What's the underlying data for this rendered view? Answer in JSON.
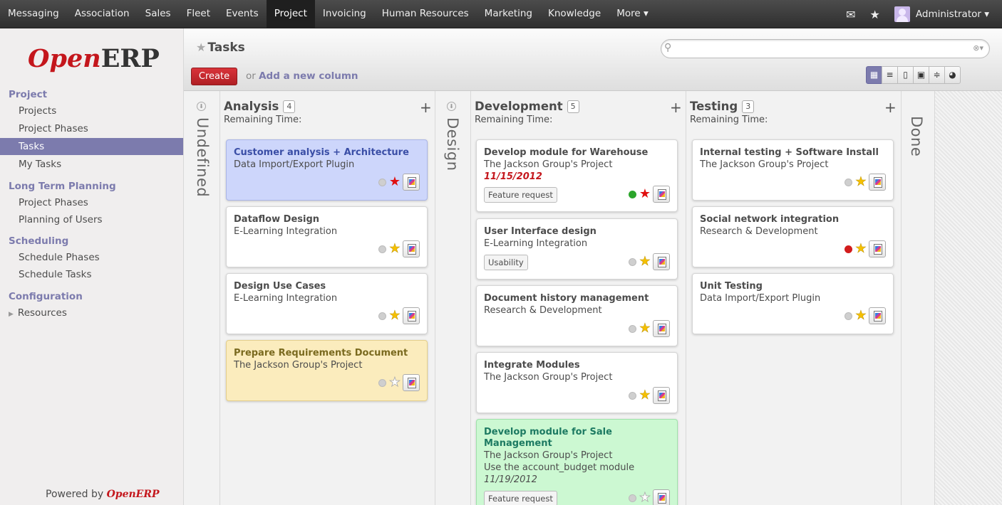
{
  "topbar": {
    "menu": [
      "Messaging",
      "Association",
      "Sales",
      "Fleet",
      "Events",
      "Project",
      "Invoicing",
      "Human Resources",
      "Marketing",
      "Knowledge",
      "More ▾"
    ],
    "active_index": 5,
    "user": "Administrator ▾"
  },
  "sidebar": {
    "logo_open": "Open",
    "logo_erp": "ERP",
    "sections": [
      {
        "title": "Project",
        "items": [
          "Projects",
          "Project Phases",
          "Tasks",
          "My Tasks"
        ]
      },
      {
        "title": "Long Term Planning",
        "items": [
          "Project Phases",
          "Planning of Users"
        ]
      },
      {
        "title": "Scheduling",
        "items": [
          "Schedule Phases",
          "Schedule Tasks"
        ]
      },
      {
        "title": "Configuration",
        "items": [
          "Resources"
        ]
      }
    ],
    "active_item": "Tasks",
    "powered_by": "Powered by",
    "powered_brand": "OpenERP"
  },
  "view": {
    "title": "Tasks",
    "create_label": "Create",
    "or_text": "or",
    "add_column_label": "Add a new column",
    "search_placeholder": "",
    "view_modes": [
      "kanban",
      "list",
      "form",
      "calendar",
      "gantt",
      "graph"
    ],
    "active_view": "kanban"
  },
  "kanban": {
    "folded": [
      "Undefined",
      "Design",
      "Done"
    ],
    "columns": [
      {
        "title": "Analysis",
        "count": "4",
        "remaining": "Remaining Time:",
        "cards": [
          {
            "name": "Customer analysis + Architecture",
            "project": "Data Import/Export Plugin",
            "color": "blue",
            "state": "grey",
            "star": "red"
          },
          {
            "name": "Dataflow Design",
            "project": "E-Learning Integration",
            "state": "grey",
            "star": "gold"
          },
          {
            "name": "Design Use Cases",
            "project": "E-Learning Integration",
            "state": "grey",
            "star": "gold"
          },
          {
            "name": "Prepare Requirements Document",
            "project": "The Jackson Group's Project",
            "color": "yellow",
            "state": "grey",
            "star": "grey"
          }
        ]
      },
      {
        "title": "Development",
        "count": "5",
        "remaining": "Remaining Time:",
        "cards": [
          {
            "name": "Develop module for Warehouse",
            "project": "The Jackson Group's Project",
            "date": "11/15/2012",
            "tag": "Feature request",
            "state": "green",
            "star": "red"
          },
          {
            "name": "User Interface design",
            "project": "E-Learning Integration",
            "tag": "Usability",
            "state": "grey",
            "star": "gold"
          },
          {
            "name": "Document history management",
            "project": "Research & Development",
            "state": "grey",
            "star": "gold"
          },
          {
            "name": "Integrate Modules",
            "project": "The Jackson Group's Project",
            "state": "grey",
            "star": "gold"
          },
          {
            "name": "Develop module for Sale Management",
            "project": "The Jackson Group's Project",
            "description": "Use the account_budget module",
            "date": "11/19/2012",
            "tag": "Feature request",
            "color": "green",
            "state": "grey",
            "star": "grey"
          }
        ]
      },
      {
        "title": "Testing",
        "count": "3",
        "remaining": "Remaining Time:",
        "cards": [
          {
            "name": "Internal testing + Software Install",
            "project": "The Jackson Group's Project",
            "state": "grey",
            "star": "gold"
          },
          {
            "name": "Social network integration",
            "project": "Research & Development",
            "state": "red",
            "star": "gold"
          },
          {
            "name": "Unit Testing",
            "project": "Data Import/Export Plugin",
            "state": "grey",
            "star": "gold"
          }
        ]
      }
    ]
  },
  "colors": {
    "accent": "#7c7bad",
    "brand_red": "#c4161c",
    "blue_card": "#cdd6fb",
    "yellow_card": "#fbecbd",
    "green_card": "#ccf8d2"
  }
}
